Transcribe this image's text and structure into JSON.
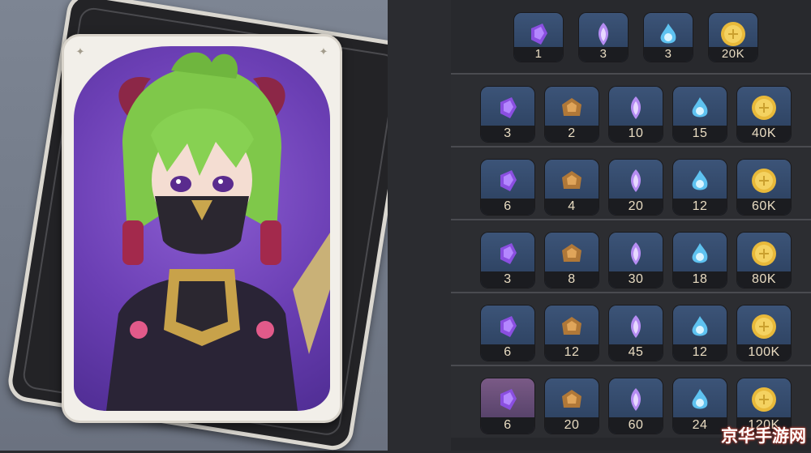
{
  "card": {
    "character": "Kuki-style masked character card"
  },
  "rows": [
    {
      "items": [
        {
          "icon": "purple-gem-icon",
          "count": "1"
        },
        {
          "icon": "violet-crystal-icon",
          "count": "3"
        },
        {
          "icon": "blue-flame-icon",
          "count": "3"
        },
        {
          "icon": "gold-coin-icon",
          "count": "20K"
        }
      ]
    },
    {
      "items": [
        {
          "icon": "purple-gem-icon",
          "count": "3"
        },
        {
          "icon": "bronze-material-icon",
          "count": "2"
        },
        {
          "icon": "violet-crystal-icon",
          "count": "10"
        },
        {
          "icon": "blue-flame-icon",
          "count": "15"
        },
        {
          "icon": "gold-coin-icon",
          "count": "40K"
        }
      ]
    },
    {
      "items": [
        {
          "icon": "purple-gem-icon",
          "count": "6"
        },
        {
          "icon": "bronze-material-icon",
          "count": "4"
        },
        {
          "icon": "violet-crystal-icon",
          "count": "20"
        },
        {
          "icon": "blue-flame-icon",
          "count": "12"
        },
        {
          "icon": "gold-coin-icon",
          "count": "60K"
        }
      ]
    },
    {
      "items": [
        {
          "icon": "purple-gem-icon",
          "count": "3"
        },
        {
          "icon": "bronze-material-icon",
          "count": "8"
        },
        {
          "icon": "violet-crystal-icon",
          "count": "30"
        },
        {
          "icon": "blue-flame-icon",
          "count": "18"
        },
        {
          "icon": "gold-coin-icon",
          "count": "80K"
        }
      ]
    },
    {
      "items": [
        {
          "icon": "purple-gem-icon",
          "count": "6"
        },
        {
          "icon": "bronze-material-icon",
          "count": "12"
        },
        {
          "icon": "violet-crystal-icon",
          "count": "45"
        },
        {
          "icon": "blue-flame-icon",
          "count": "12"
        },
        {
          "icon": "gold-coin-icon",
          "count": "100K"
        }
      ]
    },
    {
      "items": [
        {
          "icon": "purple-gem-icon",
          "count": "6"
        },
        {
          "icon": "bronze-material-icon",
          "count": "20"
        },
        {
          "icon": "violet-crystal-icon",
          "count": "60"
        },
        {
          "icon": "blue-flame-icon",
          "count": "24"
        },
        {
          "icon": "gold-coin-icon",
          "count": "120K"
        }
      ]
    }
  ],
  "watermark": "京华手游网",
  "colors": {
    "count_text": "#e9dcc2",
    "tile_bg": "#2e4466",
    "card_purple": "#6b3fb4",
    "gold": "#e8b93a"
  }
}
